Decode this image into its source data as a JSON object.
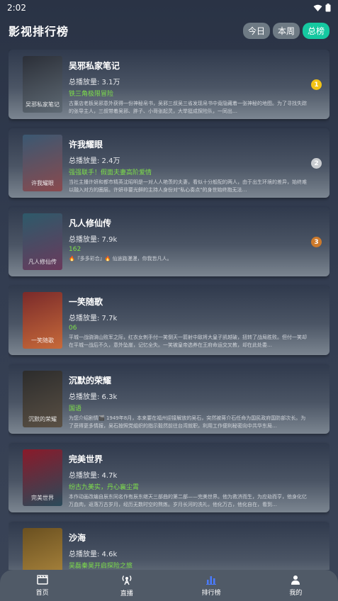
{
  "status_bar": {
    "time": "2:02"
  },
  "header": {
    "title": "影视排行榜",
    "tabs": [
      {
        "label": "今日",
        "active": false
      },
      {
        "label": "本周",
        "active": false
      },
      {
        "label": "总榜",
        "active": true
      }
    ]
  },
  "ranking": [
    {
      "title": "吴邪私家笔记",
      "plays": "总播放量: 3.1万",
      "tagline": "铁三角极限冒险",
      "desc": "古董店老板吴邪意外获得一份神秘帛书，吴邪三叔吴三省发现帛书中竟隐藏着一张神秘的地图。为了寻找失踪的张导主人，三叔带着吴邪、胖子、小哥张起灵，大举挺成探险队，一同出…",
      "rank": "1",
      "poster_caption": "吴邪私家笔记",
      "colors": [
        "#2b2f38",
        "#5f6a74"
      ]
    },
    {
      "title": "许我耀眼",
      "plays": "总播放量: 2.4万",
      "tagline": "强强联手！假面夫妻高阶爱情",
      "desc": "当社主播许妍和都市精英沈昭明是一对人人艳羡的夫妻，看似十分般配的两人，由于出生环境的差异，始终难以融入对方的圈层。许妍非要光鲜的主持人身份对\"私心奏点\"的身世始终抱无法…",
      "rank": "2",
      "poster_caption": "许我耀眼",
      "colors": [
        "#3a5872",
        "#8a4a4e"
      ]
    },
    {
      "title": "凡人修仙传",
      "plays": "总播放量: 7.9k",
      "tagline": "162",
      "desc": "🔥『多多彩合』🔥    仙途路漫漫，你我皆凡人。",
      "rank": "3",
      "poster_caption": "凡人修仙传",
      "colors": [
        "#2d5a6a",
        "#6a3a5c"
      ]
    },
    {
      "title": "一笑随歌",
      "plays": "总播放量: 7.7k",
      "tagline": "06",
      "desc": "平城一战骁骑山败军之际，红衣女刺手付一笑倒天一箭射中敌将大皇子凯越破，扭转了战局胜败。但付一笑却在平城一战后不久，意外坠崖，记忆全失。一笑被皇帝选养在王府命运交叉教，却在此处委…",
      "rank": "",
      "poster_caption": "一笑随歌",
      "colors": [
        "#7a2a2a",
        "#c76a3a"
      ]
    },
    {
      "title": "沉默的荣耀",
      "plays": "总播放量: 6.3k",
      "tagline": "国语",
      "desc": "为您介绍剧情🎬 1949年8月，本来要在福州迎接解放的吴石，突然被蒋介石任命为国民政府国防部次长。为了获得更多情报，吴石按照党组织的指示毅然前往台湾就职，利用工作便利秘密向中共华东局…",
      "rank": "",
      "poster_caption": "沉默的荣耀",
      "colors": [
        "#2c2c2c",
        "#5a5044"
      ]
    },
    {
      "title": "完美世界",
      "plays": "总播放量: 4.7k",
      "tagline": "纷古九美实，丹心襄尘霄",
      "desc": "本作动画改编自辰东同名作有辰东继天三部曲的第二部——完美世界。他为救济而生，为应劫而亨，他身化亿万血肉，返落万古岁月，经历无数时空的熬炼。岁月长河的洗礼，他化万古，他化自在，看到…",
      "rank": "",
      "poster_caption": "完美世界",
      "colors": [
        "#8a1a2a",
        "#2a4a5a"
      ]
    },
    {
      "title": "沙海",
      "plays": "总播放量: 4.6k",
      "tagline": "吴磊秦昊开启探险之旅",
      "desc": "",
      "rank": "",
      "poster_caption": "沙海",
      "colors": [
        "#6a5020",
        "#b08a40"
      ]
    }
  ],
  "bottom_nav": [
    {
      "label": "首页",
      "icon": "clapperboard-icon",
      "active": false
    },
    {
      "label": "直播",
      "icon": "live-antenna-icon",
      "active": false
    },
    {
      "label": "排行榜",
      "icon": "bar-chart-icon",
      "active": true
    },
    {
      "label": "我的",
      "icon": "user-icon",
      "active": false
    }
  ],
  "accent_color": "#15c8a0",
  "tagline_color": "#7ee04a",
  "rank_colors": {
    "1": "#f3c316",
    "2": "#c9ccd0",
    "3": "#cd7a2c"
  }
}
